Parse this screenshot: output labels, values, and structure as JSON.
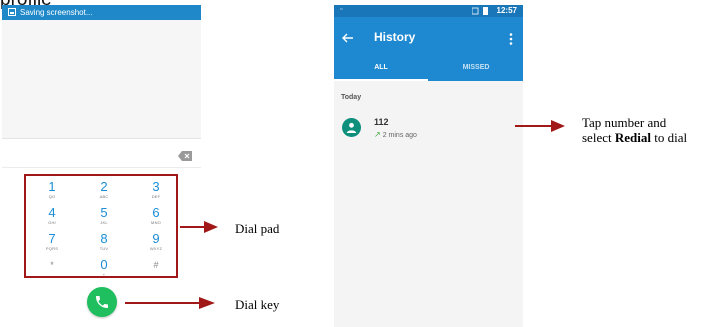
{
  "page": {
    "top_text": "profile"
  },
  "left_phone": {
    "notification_text": "Saving screenshot...",
    "keys": [
      {
        "digit": "1",
        "letters": "QO"
      },
      {
        "digit": "2",
        "letters": "ABC"
      },
      {
        "digit": "3",
        "letters": "DEF"
      },
      {
        "digit": "4",
        "letters": "GHI"
      },
      {
        "digit": "5",
        "letters": "JKL"
      },
      {
        "digit": "6",
        "letters": "MNO"
      },
      {
        "digit": "7",
        "letters": "PQRS"
      },
      {
        "digit": "8",
        "letters": "TUV"
      },
      {
        "digit": "9",
        "letters": "WXYZ"
      },
      {
        "digit": "*",
        "letters": ""
      },
      {
        "digit": "0",
        "letters": "+"
      },
      {
        "digit": "#",
        "letters": ""
      }
    ]
  },
  "right_phone": {
    "status_time": "12:57",
    "title": "History",
    "tabs": [
      "ALL",
      "MISSED"
    ],
    "section_header": "Today",
    "call": {
      "number": "112",
      "time": "2 mins ago"
    }
  },
  "annotations": {
    "dial_pad": "Dial pad",
    "dial_key": "Dial key",
    "tap_line1": "Tap number and",
    "tap_line2_prefix": "select ",
    "tap_line2_bold": "Redial",
    "tap_line2_suffix": " to dial"
  },
  "colors": {
    "accent_blue": "#1e88d0",
    "dial_green": "#1fbf5f",
    "annotation_red": "#a01818"
  }
}
